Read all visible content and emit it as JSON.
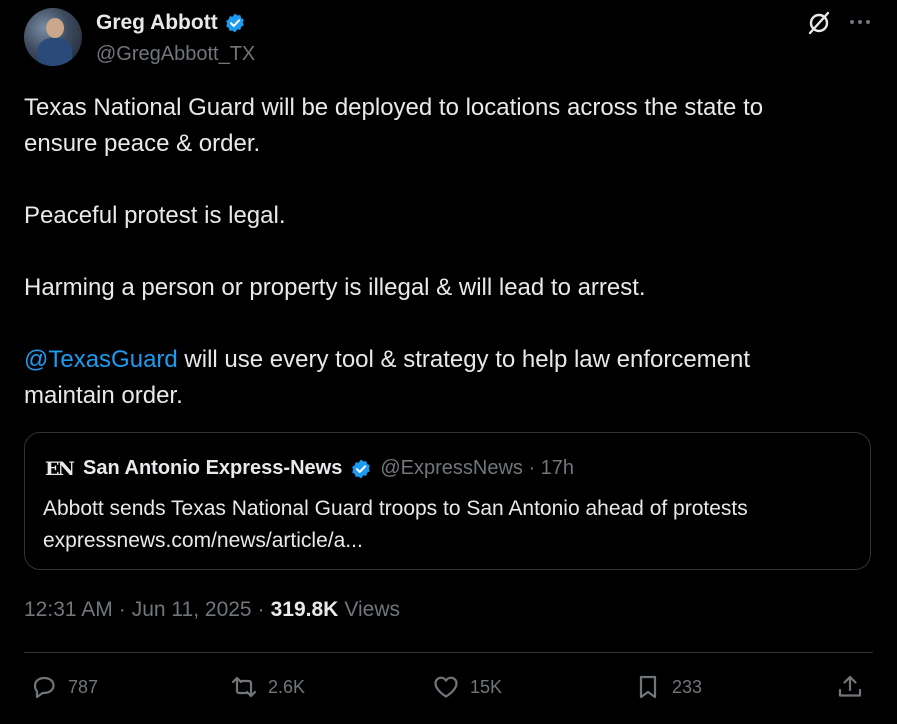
{
  "author": {
    "display_name": "Greg Abbott",
    "handle": "@GregAbbott_TX"
  },
  "tweet": {
    "lines": [
      "Texas National Guard will be deployed to locations across the state to",
      "ensure peace & order.",
      "Peaceful protest is legal.",
      "Harming a person or property is illegal & will lead to arrest.",
      "@TexasGuard",
      " will use every tool & strategy to help law enforcement",
      "maintain order."
    ]
  },
  "quote": {
    "logo_text": "EN",
    "name": "San Antonio Express-News",
    "handle_time": "@ExpressNews · 17h",
    "headline": "Abbott sends Texas National Guard troops to San Antonio ahead of protests",
    "link": "expressnews.com/news/article/a..."
  },
  "meta": {
    "time": "12:31 AM",
    "sep1": "·",
    "date": "Jun 11, 2025",
    "sep2": "·",
    "views_count": "319.8K",
    "views_label": "Views"
  },
  "actions": {
    "replies": "787",
    "reposts": "2.6K",
    "likes": "15K",
    "bookmarks": "233"
  },
  "colors": {
    "background": "#000000",
    "text": "#e7e9ea",
    "secondary": "#71767b",
    "link": "#1d9bf0",
    "border": "#2f3336"
  }
}
